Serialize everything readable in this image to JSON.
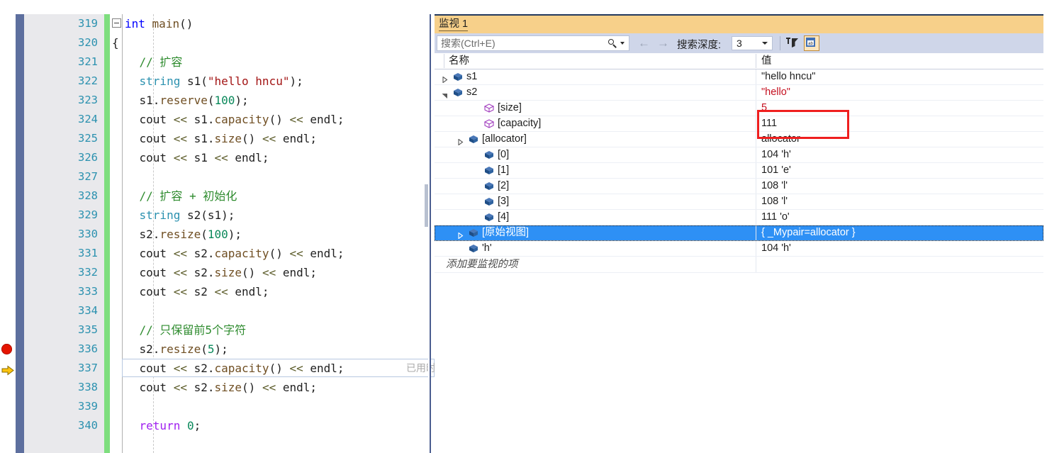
{
  "editor": {
    "lines": [
      {
        "num": "319",
        "indent": 0,
        "fold": true,
        "tokens": [
          {
            "t": "int",
            "c": "kw"
          },
          {
            "t": " ",
            "c": "plain"
          },
          {
            "t": "main",
            "c": "fn"
          },
          {
            "t": "()",
            "c": "plain"
          }
        ]
      },
      {
        "num": "320",
        "tokens": [
          {
            "t": "{",
            "c": "plain"
          }
        ]
      },
      {
        "num": "321",
        "tokens": [
          {
            "t": "    // 扩容",
            "c": "cmt"
          }
        ]
      },
      {
        "num": "322",
        "tokens": [
          {
            "t": "    ",
            "c": "plain"
          },
          {
            "t": "string",
            "c": "kw2"
          },
          {
            "t": " s1(",
            "c": "plain"
          },
          {
            "t": "\"hello hncu\"",
            "c": "str"
          },
          {
            "t": ");",
            "c": "plain"
          }
        ]
      },
      {
        "num": "323",
        "tokens": [
          {
            "t": "    s1.",
            "c": "plain"
          },
          {
            "t": "reserve",
            "c": "fn"
          },
          {
            "t": "(",
            "c": "plain"
          },
          {
            "t": "100",
            "c": "num"
          },
          {
            "t": ");",
            "c": "plain"
          }
        ]
      },
      {
        "num": "324",
        "tokens": [
          {
            "t": "    cout ",
            "c": "plain"
          },
          {
            "t": "<<",
            "c": "op"
          },
          {
            "t": " s1.",
            "c": "plain"
          },
          {
            "t": "capacity",
            "c": "fn"
          },
          {
            "t": "() ",
            "c": "plain"
          },
          {
            "t": "<<",
            "c": "op"
          },
          {
            "t": " endl;",
            "c": "plain"
          }
        ]
      },
      {
        "num": "325",
        "tokens": [
          {
            "t": "    cout ",
            "c": "plain"
          },
          {
            "t": "<<",
            "c": "op"
          },
          {
            "t": " s1.",
            "c": "plain"
          },
          {
            "t": "size",
            "c": "fn"
          },
          {
            "t": "() ",
            "c": "plain"
          },
          {
            "t": "<<",
            "c": "op"
          },
          {
            "t": " endl;",
            "c": "plain"
          }
        ]
      },
      {
        "num": "326",
        "tokens": [
          {
            "t": "    cout ",
            "c": "plain"
          },
          {
            "t": "<<",
            "c": "op"
          },
          {
            "t": " s1 ",
            "c": "plain"
          },
          {
            "t": "<<",
            "c": "op"
          },
          {
            "t": " endl;",
            "c": "plain"
          }
        ]
      },
      {
        "num": "327",
        "tokens": []
      },
      {
        "num": "328",
        "tokens": [
          {
            "t": "    // 扩容 + 初始化",
            "c": "cmt"
          }
        ]
      },
      {
        "num": "329",
        "tokens": [
          {
            "t": "    ",
            "c": "plain"
          },
          {
            "t": "string",
            "c": "kw2"
          },
          {
            "t": " s2(s1);",
            "c": "plain"
          }
        ]
      },
      {
        "num": "330",
        "tokens": [
          {
            "t": "    s2.",
            "c": "plain"
          },
          {
            "t": "resize",
            "c": "fn"
          },
          {
            "t": "(",
            "c": "plain"
          },
          {
            "t": "100",
            "c": "num"
          },
          {
            "t": ");",
            "c": "plain"
          }
        ]
      },
      {
        "num": "331",
        "tokens": [
          {
            "t": "    cout ",
            "c": "plain"
          },
          {
            "t": "<<",
            "c": "op"
          },
          {
            "t": " s2.",
            "c": "plain"
          },
          {
            "t": "capacity",
            "c": "fn"
          },
          {
            "t": "() ",
            "c": "plain"
          },
          {
            "t": "<<",
            "c": "op"
          },
          {
            "t": " endl;",
            "c": "plain"
          }
        ]
      },
      {
        "num": "332",
        "tokens": [
          {
            "t": "    cout ",
            "c": "plain"
          },
          {
            "t": "<<",
            "c": "op"
          },
          {
            "t": " s2.",
            "c": "plain"
          },
          {
            "t": "size",
            "c": "fn"
          },
          {
            "t": "() ",
            "c": "plain"
          },
          {
            "t": "<<",
            "c": "op"
          },
          {
            "t": " endl;",
            "c": "plain"
          }
        ]
      },
      {
        "num": "333",
        "tokens": [
          {
            "t": "    cout ",
            "c": "plain"
          },
          {
            "t": "<<",
            "c": "op"
          },
          {
            "t": " s2 ",
            "c": "plain"
          },
          {
            "t": "<<",
            "c": "op"
          },
          {
            "t": " endl;",
            "c": "plain"
          }
        ]
      },
      {
        "num": "334",
        "tokens": []
      },
      {
        "num": "335",
        "tokens": [
          {
            "t": "    // 只保留前5个字符",
            "c": "cmt"
          }
        ]
      },
      {
        "num": "336",
        "breakpoint": true,
        "tokens": [
          {
            "t": "    s2.",
            "c": "plain"
          },
          {
            "t": "resize",
            "c": "fn"
          },
          {
            "t": "(",
            "c": "plain"
          },
          {
            "t": "5",
            "c": "num"
          },
          {
            "t": ");",
            "c": "plain"
          }
        ]
      },
      {
        "num": "337",
        "current": true,
        "elapsed": "已用时",
        "tokens": [
          {
            "t": "    cout ",
            "c": "plain"
          },
          {
            "t": "<<",
            "c": "op"
          },
          {
            "t": " s2.",
            "c": "plain"
          },
          {
            "t": "capacity",
            "c": "fn"
          },
          {
            "t": "() ",
            "c": "plain"
          },
          {
            "t": "<<",
            "c": "op"
          },
          {
            "t": " endl;",
            "c": "plain"
          }
        ]
      },
      {
        "num": "338",
        "tokens": [
          {
            "t": "    cout ",
            "c": "plain"
          },
          {
            "t": "<<",
            "c": "op"
          },
          {
            "t": " s2.",
            "c": "plain"
          },
          {
            "t": "size",
            "c": "fn"
          },
          {
            "t": "() ",
            "c": "plain"
          },
          {
            "t": "<<",
            "c": "op"
          },
          {
            "t": " endl;",
            "c": "plain"
          }
        ]
      },
      {
        "num": "339",
        "tokens": []
      },
      {
        "num": "340",
        "tokens": [
          {
            "t": "    ",
            "c": "plain"
          },
          {
            "t": "return",
            "c": "pur"
          },
          {
            "t": " ",
            "c": "plain"
          },
          {
            "t": "0",
            "c": "num"
          },
          {
            "t": ";",
            "c": "plain"
          }
        ]
      }
    ]
  },
  "watch": {
    "title": "监视 1",
    "search_placeholder": "搜索(Ctrl+E)",
    "depth_label": "搜索深度:",
    "depth_value": "3",
    "columns": {
      "name": "名称",
      "value": "值"
    },
    "add_watch_placeholder": "添加要监视的项",
    "rows": [
      {
        "name": "s1",
        "value": "\"hello hncu\"",
        "indent": 0,
        "expander": "collapsed",
        "icon": "cube-blue-icon",
        "value_changed": false
      },
      {
        "name": "s2",
        "value": "\"hello\"",
        "indent": 0,
        "expander": "expanded",
        "icon": "cube-blue-icon",
        "value_changed": true
      },
      {
        "name": "[size]",
        "value": "5",
        "indent": 2,
        "expander": "none",
        "icon": "cube-purple-icon",
        "value_changed": true
      },
      {
        "name": "[capacity]",
        "value": "111",
        "indent": 2,
        "expander": "none",
        "icon": "cube-purple-icon",
        "value_changed": false
      },
      {
        "name": "[allocator]",
        "value": "allocator",
        "indent": 1,
        "expander": "collapsed",
        "icon": "cube-blue-icon",
        "value_changed": false
      },
      {
        "name": "[0]",
        "value": "104 'h'",
        "indent": 2,
        "expander": "none",
        "icon": "cube-blue-icon",
        "value_changed": false
      },
      {
        "name": "[1]",
        "value": "101 'e'",
        "indent": 2,
        "expander": "none",
        "icon": "cube-blue-icon",
        "value_changed": false
      },
      {
        "name": "[2]",
        "value": "108 'l'",
        "indent": 2,
        "expander": "none",
        "icon": "cube-blue-icon",
        "value_changed": false
      },
      {
        "name": "[3]",
        "value": "108 'l'",
        "indent": 2,
        "expander": "none",
        "icon": "cube-blue-icon",
        "value_changed": false
      },
      {
        "name": "[4]",
        "value": "111 'o'",
        "indent": 2,
        "expander": "none",
        "icon": "cube-blue-icon",
        "value_changed": false
      },
      {
        "name": "[原始视图]",
        "value": "{ _Mypair=allocator }",
        "indent": 1,
        "expander": "collapsed",
        "icon": "cube-blue-icon",
        "selected": true,
        "value_changed": false
      },
      {
        "name": "'h'",
        "value": "104 'h'",
        "indent": 1,
        "expander": "none",
        "icon": "cube-blue-icon",
        "value_changed": false
      }
    ]
  },
  "colors": {
    "title_bar": "#f7d08a",
    "toolbar": "#cfd6e9",
    "selection": "#2e90f5",
    "changed_value": "#c50f1f",
    "highlight_box": "#ef1f1f",
    "change_bar": "#7ede7e",
    "breakpoint": "#e51400",
    "current_arrow": "#ffc40d"
  }
}
